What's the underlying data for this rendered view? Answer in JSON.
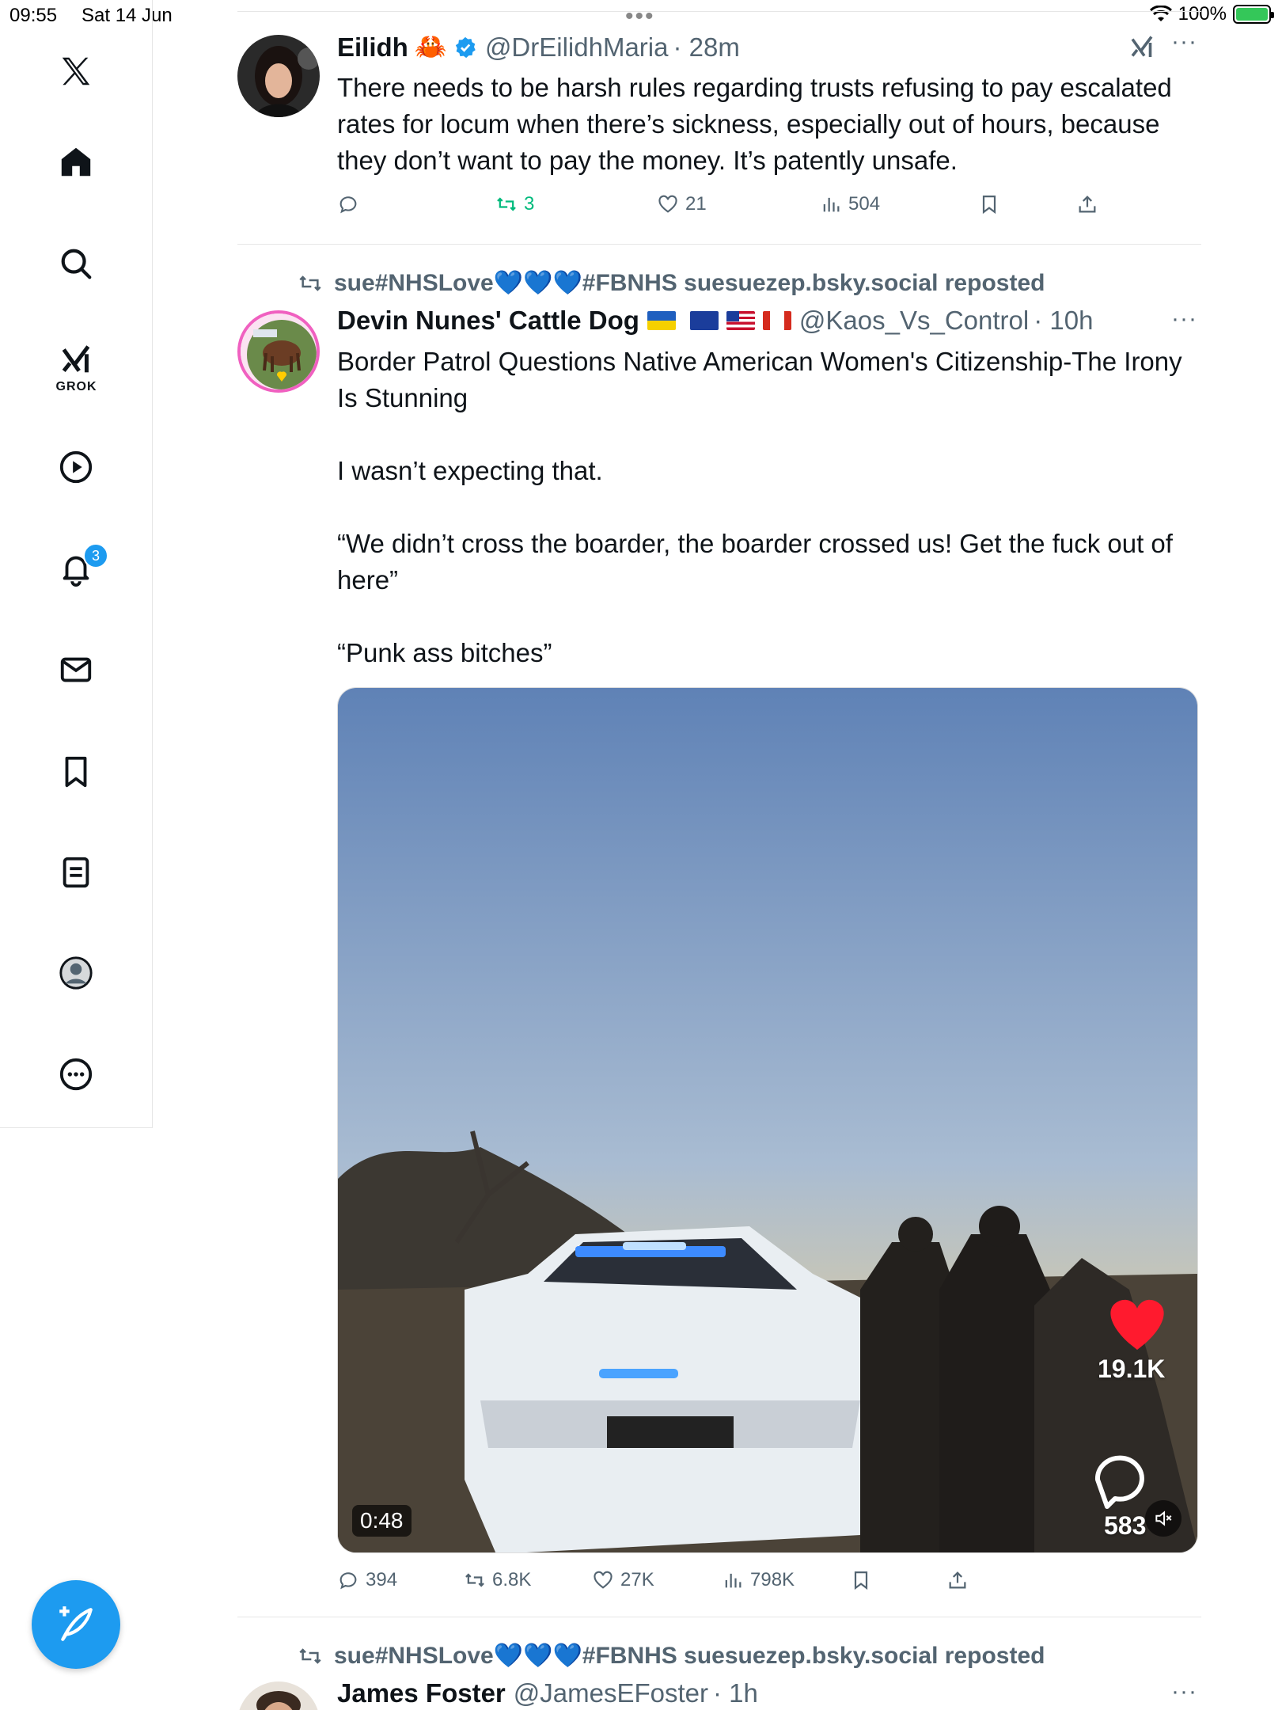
{
  "status_bar": {
    "time": "09:55",
    "date": "Sat 14 Jun",
    "battery": "100%"
  },
  "sidebar": {
    "grok_label": "GROK",
    "notifications_badge": "3"
  },
  "tweets": [
    {
      "name": "Eilidh",
      "name_emoji": "🦀",
      "verified": true,
      "handle": "@DrEilidhMaria",
      "time": "· 28m",
      "text": "There needs to be harsh rules regarding trusts refusing to pay escalated rates for locum when there’s sickness, especially out of hours, because they don’t want to pay the money. It’s patently unsafe.",
      "replies": "",
      "retweets": "3",
      "likes": "21",
      "views": "504"
    },
    {
      "repost_by": "sue#NHSLove💙💙💙#FBNHS suesuezep.bsky.social reposted",
      "name": "Devin Nunes' Cattle Dog",
      "handle": "@Kaos_Vs_Control",
      "time": "· 10h",
      "text": "Border Patrol Questions Native American Women's Citizenship-The Irony Is Stunning\n\nI wasn’t expecting that.\n\n“We didn’t cross the boarder, the boarder crossed us!  Get the fuck out of here”\n\n“Punk ass bitches”",
      "video": {
        "duration": "0:48",
        "overlay_likes": "19.1K",
        "overlay_comments": "583"
      },
      "replies": "394",
      "retweets": "6.8K",
      "likes": "27K",
      "views": "798K"
    },
    {
      "repost_by": "sue#NHSLove💙💙💙#FBNHS suesuezep.bsky.social reposted",
      "name": "James Foster",
      "handle": "@JamesEFoster",
      "time": "· 1h"
    }
  ],
  "colors": {
    "accent": "#1d9bf0",
    "retweet_active": "#00ba7c",
    "secondary_text": "#536471"
  }
}
